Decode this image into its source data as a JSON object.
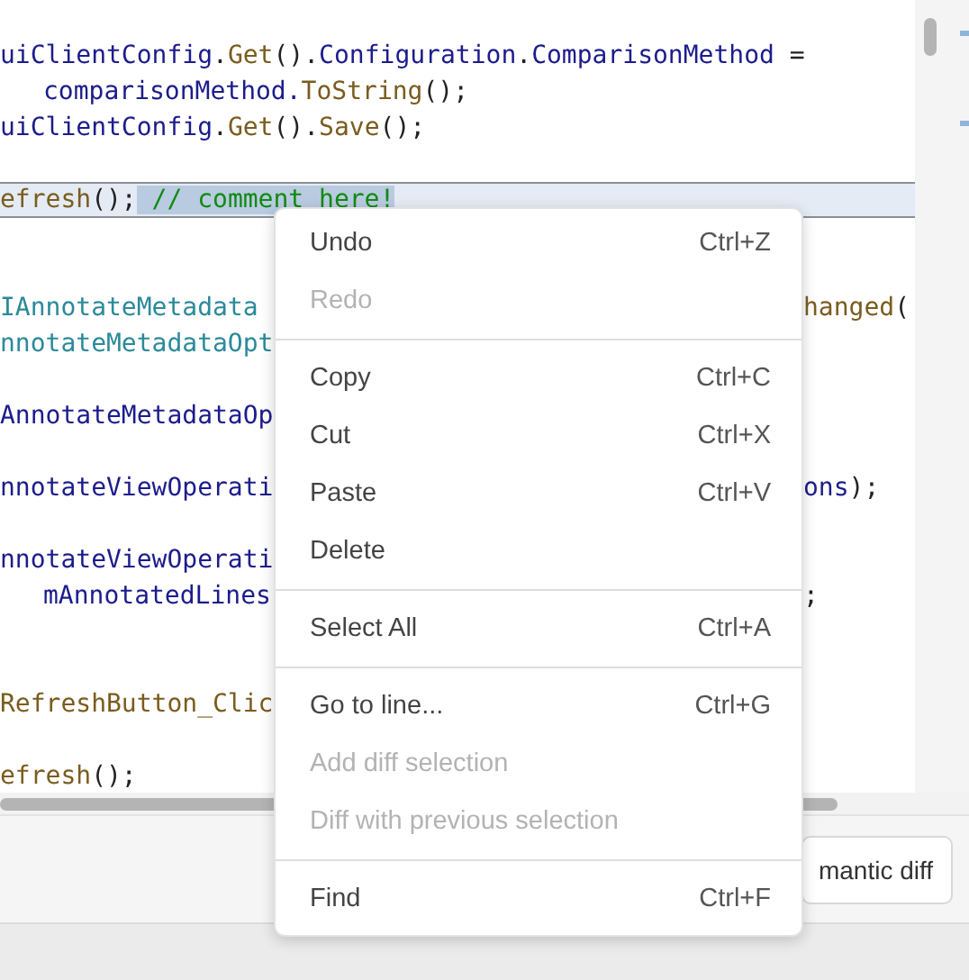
{
  "editor": {
    "lines": [
      {
        "current": false,
        "indent": false,
        "tokens": [
          {
            "kind": "id",
            "text": "uiClientConfig"
          },
          {
            "kind": "punct",
            "text": "."
          },
          {
            "kind": "method",
            "text": "Get"
          },
          {
            "kind": "punct",
            "text": "()."
          },
          {
            "kind": "id",
            "text": "Configuration"
          },
          {
            "kind": "punct",
            "text": "."
          },
          {
            "kind": "id",
            "text": "ComparisonMethod"
          },
          {
            "kind": "punct",
            "text": " ="
          }
        ]
      },
      {
        "current": false,
        "indent": true,
        "tokens": [
          {
            "kind": "id",
            "text": "comparisonMethod."
          },
          {
            "kind": "method",
            "text": "ToString"
          },
          {
            "kind": "punct",
            "text": "();"
          }
        ]
      },
      {
        "current": false,
        "indent": false,
        "tokens": [
          {
            "kind": "id",
            "text": "uiClientConfig"
          },
          {
            "kind": "punct",
            "text": "."
          },
          {
            "kind": "method",
            "text": "Get"
          },
          {
            "kind": "punct",
            "text": "()."
          },
          {
            "kind": "method",
            "text": "Save"
          },
          {
            "kind": "punct",
            "text": "();"
          }
        ]
      },
      {
        "current": false
      },
      {
        "current": true,
        "indent": false,
        "tokens": [
          {
            "kind": "method",
            "text": "efresh",
            "selected": false
          },
          {
            "kind": "punct",
            "text": "();",
            "selected": false
          },
          {
            "kind": "comment",
            "text": " // comment here!",
            "selected": true
          }
        ]
      },
      {
        "current": false
      },
      {
        "current": false
      },
      {
        "current": false,
        "indent": false,
        "tokens": [
          {
            "kind": "type",
            "text": "IAnnotateMetadata"
          }
        ],
        "right": [
          {
            "kind": "method",
            "text": "hanged"
          },
          {
            "kind": "punct",
            "text": "("
          }
        ]
      },
      {
        "current": false,
        "indent": false,
        "tokens": [
          {
            "kind": "type",
            "text": "nnotateMetadataOpt"
          }
        ]
      },
      {
        "current": false
      },
      {
        "current": false,
        "indent": false,
        "tokens": [
          {
            "kind": "id",
            "text": "AnnotateMetadataOp"
          }
        ]
      },
      {
        "current": false
      },
      {
        "current": false,
        "indent": false,
        "tokens": [
          {
            "kind": "id",
            "text": "nnotateViewOperati"
          }
        ],
        "right": [
          {
            "kind": "id",
            "text": "ons"
          },
          {
            "kind": "punct",
            "text": ");"
          }
        ]
      },
      {
        "current": false
      },
      {
        "current": false,
        "indent": false,
        "tokens": [
          {
            "kind": "id",
            "text": "nnotateViewOperati"
          }
        ]
      },
      {
        "current": false,
        "indent": true,
        "tokens": [
          {
            "kind": "id",
            "text": "mAnnotatedLines"
          }
        ],
        "right": [
          {
            "kind": "punct",
            "text": ";"
          }
        ]
      },
      {
        "current": false
      },
      {
        "current": false
      },
      {
        "current": false,
        "indent": false,
        "tokens": [
          {
            "kind": "method",
            "text": "RefreshButton_Clic"
          }
        ]
      },
      {
        "current": false
      },
      {
        "current": false,
        "indent": false,
        "tokens": [
          {
            "kind": "method",
            "text": "efresh"
          },
          {
            "kind": "punct",
            "text": "();"
          }
        ]
      }
    ]
  },
  "bottom_panel": {
    "button": "mantic diff"
  },
  "context_menu": [
    {
      "kind": "item",
      "label": "Undo",
      "shortcut": "Ctrl+Z",
      "disabled": false
    },
    {
      "kind": "item",
      "label": "Redo",
      "disabled": true
    },
    {
      "kind": "separator"
    },
    {
      "kind": "item",
      "label": "Copy",
      "shortcut": "Ctrl+C",
      "disabled": false
    },
    {
      "kind": "item",
      "label": "Cut",
      "shortcut": "Ctrl+X",
      "disabled": false
    },
    {
      "kind": "item",
      "label": "Paste",
      "shortcut": "Ctrl+V",
      "disabled": false
    },
    {
      "kind": "item",
      "label": "Delete",
      "disabled": false
    },
    {
      "kind": "separator"
    },
    {
      "kind": "item",
      "label": "Select All",
      "shortcut": "Ctrl+A",
      "disabled": false
    },
    {
      "kind": "separator"
    },
    {
      "kind": "item",
      "label": "Go to line...",
      "shortcut": "Ctrl+G",
      "disabled": false
    },
    {
      "kind": "item",
      "label": "Add diff selection",
      "disabled": true
    },
    {
      "kind": "item",
      "label": "Diff with previous selection",
      "disabled": true
    },
    {
      "kind": "separator"
    },
    {
      "kind": "item",
      "label": "Find",
      "shortcut": "Ctrl+F",
      "disabled": false
    }
  ]
}
